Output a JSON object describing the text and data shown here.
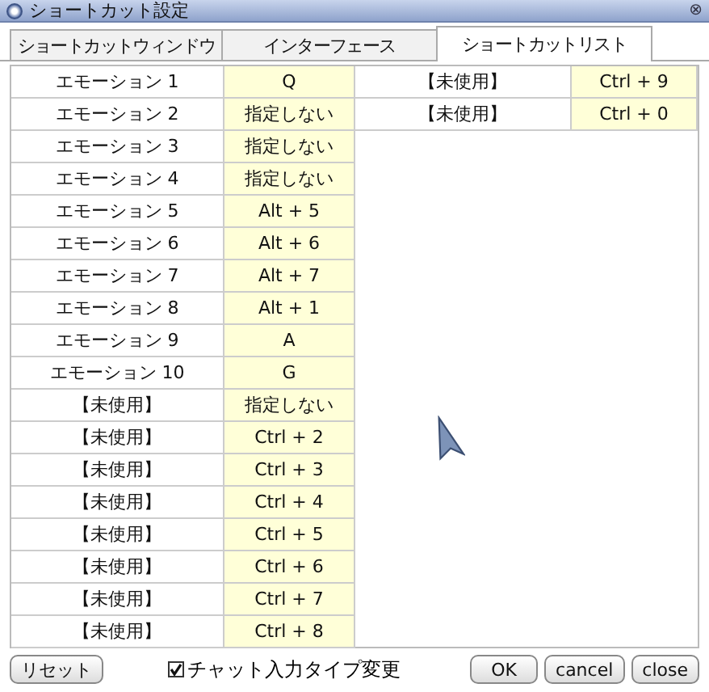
{
  "window": {
    "title": "ショートカット設定",
    "close": "⊗"
  },
  "tabs": [
    {
      "label": "ショートカットウィンドウ",
      "selected": false
    },
    {
      "label": "インターフェース",
      "selected": false
    },
    {
      "label": "ショートカットリスト",
      "selected": true
    }
  ],
  "list_left": [
    {
      "name": "エモーション 1",
      "key": "Q"
    },
    {
      "name": "エモーション 2",
      "key": "指定しない"
    },
    {
      "name": "エモーション 3",
      "key": "指定しない"
    },
    {
      "name": "エモーション 4",
      "key": "指定しない"
    },
    {
      "name": "エモーション 5",
      "key": "Alt + 5"
    },
    {
      "name": "エモーション 6",
      "key": "Alt + 6"
    },
    {
      "name": "エモーション 7",
      "key": "Alt + 7"
    },
    {
      "name": "エモーション 8",
      "key": "Alt + 1"
    },
    {
      "name": "エモーション 9",
      "key": "A"
    },
    {
      "name": "エモーション 10",
      "key": "G"
    },
    {
      "name": "【未使用】",
      "key": "指定しない"
    },
    {
      "name": "【未使用】",
      "key": "Ctrl + 2"
    },
    {
      "name": "【未使用】",
      "key": "Ctrl + 3"
    },
    {
      "name": "【未使用】",
      "key": "Ctrl + 4"
    },
    {
      "name": "【未使用】",
      "key": "Ctrl + 5"
    },
    {
      "name": "【未使用】",
      "key": "Ctrl + 6"
    },
    {
      "name": "【未使用】",
      "key": "Ctrl + 7"
    },
    {
      "name": "【未使用】",
      "key": "Ctrl + 8"
    }
  ],
  "list_right": [
    {
      "name": "【未使用】",
      "key": "Ctrl + 9"
    },
    {
      "name": "【未使用】",
      "key": "Ctrl + 0"
    }
  ],
  "footer": {
    "reset_button": "リセット",
    "checkbox": {
      "label": "チャット入力タイプ変更",
      "checked": true
    },
    "buttons": [
      "OK",
      "cancel",
      "close"
    ]
  }
}
